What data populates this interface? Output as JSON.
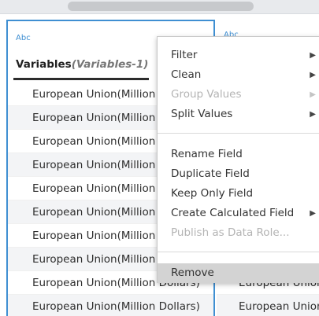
{
  "columns": [
    {
      "type_label": "Abc",
      "title": "Variables",
      "subtitle": "(Variables-1)",
      "rows": [
        "European Union(Million Dollars)",
        "European Union(Million Dollars)",
        "European Union(Million Dollars)",
        "European Union(Million Dollars)",
        "European Union(Million Dollars)",
        "European Union(Million Dollars)",
        "European Union(Million Dollars)",
        "European Union(Million Dollars)",
        "European Union(Million Dollars)",
        "European Union(Million Dollars)"
      ]
    },
    {
      "type_label": "Abc",
      "rows": [
        "European Union(Million Dollars)",
        "European Union(Million Dollars)"
      ]
    }
  ],
  "context_menu": {
    "items": [
      {
        "label": "Filter",
        "submenu": true,
        "disabled": false
      },
      {
        "label": "Clean",
        "submenu": true,
        "disabled": false
      },
      {
        "label": "Group Values",
        "submenu": true,
        "disabled": true
      },
      {
        "label": "Split Values",
        "submenu": true,
        "disabled": false
      },
      {
        "label": "Rename Field",
        "submenu": false,
        "disabled": false
      },
      {
        "label": "Duplicate Field",
        "submenu": false,
        "disabled": false
      },
      {
        "label": "Keep Only Field",
        "submenu": false,
        "disabled": false
      },
      {
        "label": "Create Calculated Field",
        "submenu": true,
        "disabled": false
      },
      {
        "label": "Publish as Data Role...",
        "submenu": false,
        "disabled": true
      },
      {
        "label": "Remove",
        "submenu": false,
        "disabled": false,
        "highlighted": true
      }
    ]
  },
  "colors": {
    "accent": "#3f8fd2",
    "menu_highlight": "#d3d3d3",
    "disabled_text": "#b4b4b4"
  },
  "icons": {
    "submenu_arrow": "chevron-right-icon"
  }
}
